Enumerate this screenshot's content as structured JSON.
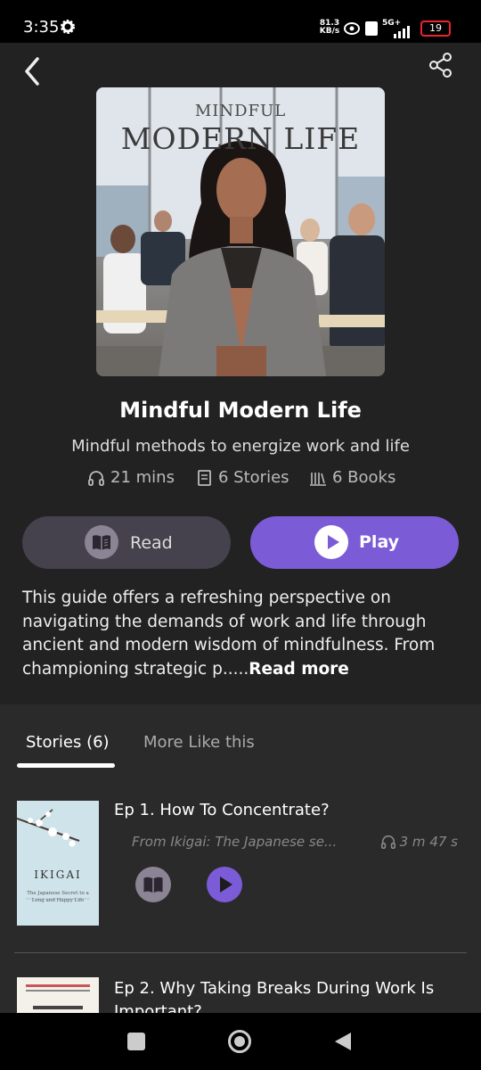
{
  "status_bar": {
    "time": "3:35",
    "speed_top": "81.3",
    "speed_bottom": "KB/s",
    "network": "5G+",
    "battery": "19"
  },
  "cover": {
    "title_line1": "MINDFUL",
    "title_line2": "MODERN LIFE"
  },
  "book": {
    "title": "Mindful Modern Life",
    "subtitle": "Mindful methods to energize work and life",
    "duration": "21 mins",
    "stories": "6 Stories",
    "books": "6 Books"
  },
  "actions": {
    "read_label": "Read",
    "play_label": "Play"
  },
  "description": {
    "text": "This guide offers a refreshing perspective on navigating the demands of work and life through ancient and modern wisdom of mindfulness. From championing strategic p.....",
    "read_more": "Read more"
  },
  "tabs": [
    {
      "label": "Stories (6)",
      "active": true
    },
    {
      "label": "More Like this",
      "active": false
    }
  ],
  "episodes": [
    {
      "title": "Ep 1. How To Concentrate?",
      "from": "From Ikigai: The Japanese se...",
      "duration": "3 m 47 s",
      "thumb_title": "IKIGAI",
      "thumb_sub": "The Japanese Secret to a Long and Happy Life"
    },
    {
      "title": "Ep 2. Why Taking Breaks During Work Is Important?"
    }
  ],
  "colors": {
    "accent": "#7b5bd6",
    "read_button": "#45414d",
    "background": "#222222"
  }
}
